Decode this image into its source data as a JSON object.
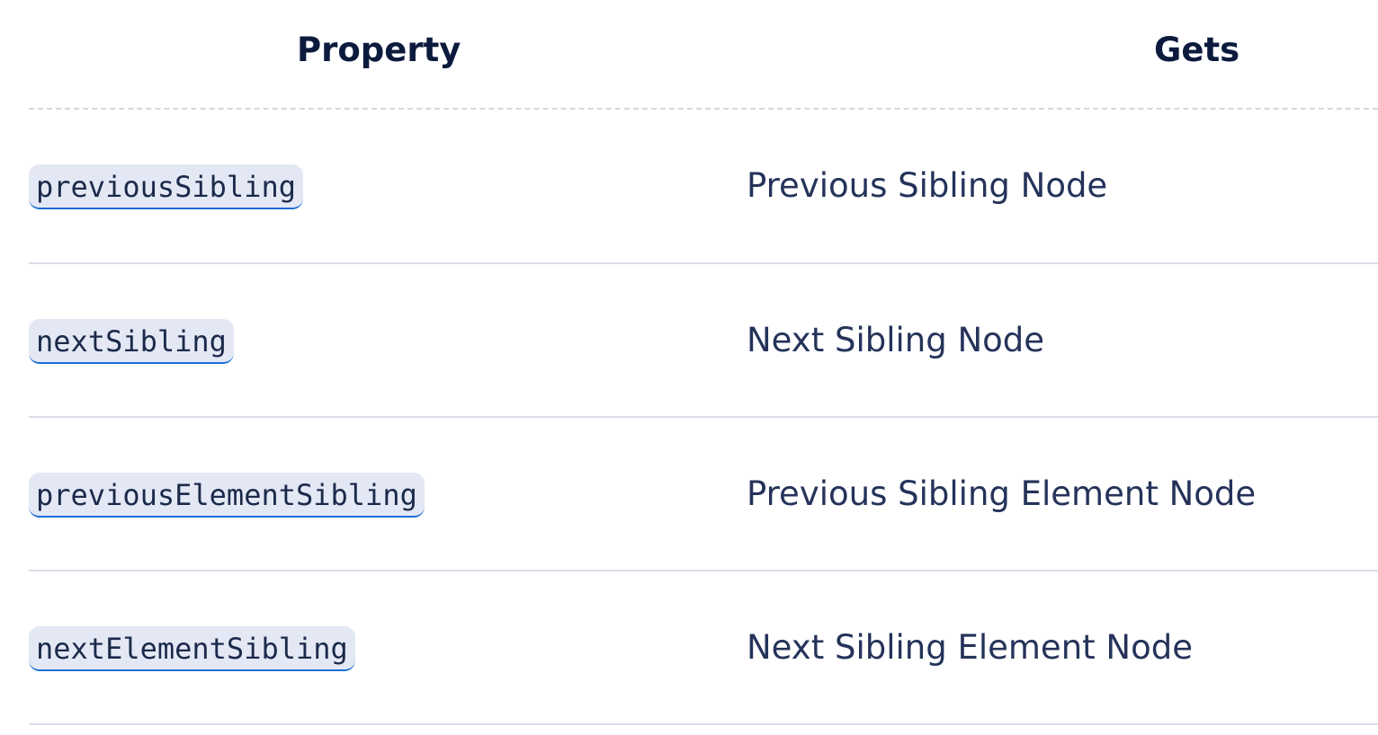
{
  "table": {
    "headers": {
      "property": "Property",
      "gets": "Gets"
    },
    "rows": [
      {
        "property": "previousSibling",
        "gets": "Previous Sibling Node"
      },
      {
        "property": "nextSibling",
        "gets": "Next Sibling Node"
      },
      {
        "property": "previousElementSibling",
        "gets": "Previous Sibling Element Node"
      },
      {
        "property": "nextElementSibling",
        "gets": "Next Sibling Element Node"
      }
    ]
  },
  "colors": {
    "link_underline": "#1a6fd6",
    "code_background": "#e4e8f5",
    "heading_text": "#0c1b3d",
    "body_text": "#25335a"
  }
}
